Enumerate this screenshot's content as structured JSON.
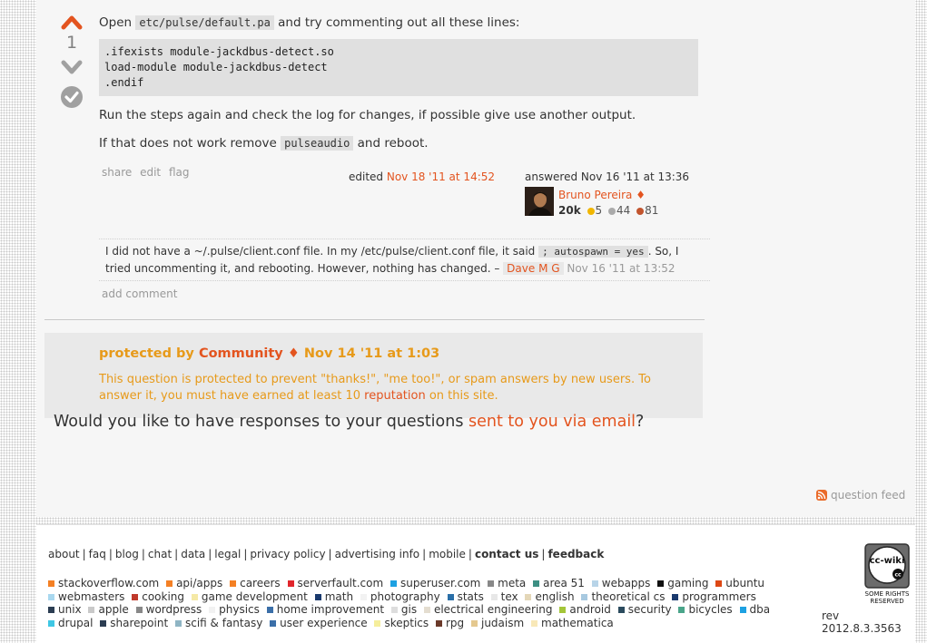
{
  "answer": {
    "vote_count": "1",
    "icons": {
      "upvote": "arrow-up-icon",
      "downvote": "arrow-down-icon",
      "accepted": "check-circle-icon"
    },
    "intro_pre": "Open ",
    "intro_code": "etc/pulse/default.pa",
    "intro_post": " and try commenting out all these lines:",
    "code_lines": ".ifexists module-jackdbus-detect.so\nload-module module-jackdbus-detect\n.endif",
    "para2": "Run the steps again and check the log for changes, if possible give use another output.",
    "para3_pre": "If that does not work remove ",
    "para3_code": "pulseaudio",
    "para3_post": " and reboot.",
    "menu": {
      "share": "share",
      "edit": "edit",
      "flag": "flag"
    },
    "edited_label": "edited ",
    "edited_date": "Nov 18 '11 at 14:52",
    "answered_label": "answered Nov 16 '11 at 13:36",
    "user": {
      "name": "Bruno Pereira",
      "moderator_diamond": "♦",
      "reputation": "20k",
      "gold": "5",
      "silver": "44",
      "bronze": "81"
    }
  },
  "comment": {
    "text_pre": "I did not have a ~/.pulse/client.conf file. In my /etc/pulse/client.conf file, it said ",
    "code": "; autospawn = yes",
    "text_post": ". So, I tried uncommenting it, and rebooting. However, nothing has changed. – ",
    "user": "Dave M G",
    "date": "Nov 16 '11 at 13:52"
  },
  "add_comment": "add comment",
  "protected": {
    "prefix": "protected by ",
    "user": "Community",
    "diamond": "♦",
    "date": "Nov 14 '11 at 1:03",
    "text_pre": "This question is protected to prevent \"thanks!\", \"me too!\", or spam answers by new users. To answer it, you must have earned at least 10 ",
    "link": "reputation",
    "text_post": " on this site."
  },
  "email_prompt": {
    "pre": "Would you like to have responses to your questions ",
    "link": "sent to you via email",
    "post": "?"
  },
  "question_feed": "question feed",
  "footer": {
    "menu": [
      {
        "label": "about",
        "bold": false
      },
      {
        "label": "faq",
        "bold": false
      },
      {
        "label": "blog",
        "bold": false
      },
      {
        "label": "chat",
        "bold": false
      },
      {
        "label": "data",
        "bold": false
      },
      {
        "label": "legal",
        "bold": false
      },
      {
        "label": "privacy policy",
        "bold": false
      },
      {
        "label": "advertising info",
        "bold": false
      },
      {
        "label": "mobile",
        "bold": false
      },
      {
        "label": "contact us",
        "bold": true
      },
      {
        "label": "feedback",
        "bold": true
      }
    ],
    "sites": [
      {
        "label": "stackoverflow.com",
        "color": "#f48024"
      },
      {
        "label": "api/apps",
        "color": "#f48024"
      },
      {
        "label": "careers",
        "color": "#f48024"
      },
      {
        "label": "serverfault.com",
        "color": "#e1262c"
      },
      {
        "label": "superuser.com",
        "color": "#1da1e2"
      },
      {
        "label": "meta",
        "color": "#888888"
      },
      {
        "label": "area 51",
        "color": "#3d8f83"
      },
      {
        "label": "webapps",
        "color": "#b8d4e8"
      },
      {
        "label": "gaming",
        "color": "#111111"
      },
      {
        "label": "ubuntu",
        "color": "#dd4814"
      },
      {
        "label": "webmasters",
        "color": "#a9d8ef"
      },
      {
        "label": "cooking",
        "color": "#c0392b"
      },
      {
        "label": "game development",
        "color": "#f5e9a6"
      },
      {
        "label": "math",
        "color": "#1a3a6e"
      },
      {
        "label": "photography",
        "color": "#f2f2f2"
      },
      {
        "label": "stats",
        "color": "#2a6fa8"
      },
      {
        "label": "tex",
        "color": "#e7e7e7"
      },
      {
        "label": "english",
        "color": "#e4d7b8"
      },
      {
        "label": "theoretical cs",
        "color": "#a8c9e0"
      },
      {
        "label": "programmers",
        "color": "#1a3a6e"
      },
      {
        "label": "unix",
        "color": "#2b3d52"
      },
      {
        "label": "apple",
        "color": "#c9c9c9"
      },
      {
        "label": "wordpress",
        "color": "#888888"
      },
      {
        "label": "physics",
        "color": "#f2f2f2"
      },
      {
        "label": "home improvement",
        "color": "#3b6fa8"
      },
      {
        "label": "gis",
        "color": "#dddddd"
      },
      {
        "label": "electrical engineering",
        "color": "#e4ddd0"
      },
      {
        "label": "android",
        "color": "#a4c639"
      },
      {
        "label": "security",
        "color": "#2b4b5e"
      },
      {
        "label": "bicycles",
        "color": "#4aa58a"
      },
      {
        "label": "dba",
        "color": "#1da1e2"
      },
      {
        "label": "drupal",
        "color": "#3fc7e4"
      },
      {
        "label": "sharepoint",
        "color": "#2b3d52"
      },
      {
        "label": "scifi & fantasy",
        "color": "#8fb5c4"
      },
      {
        "label": "user experience",
        "color": "#3b6fa8"
      },
      {
        "label": "skeptics",
        "color": "#f5ee9c"
      },
      {
        "label": "rpg",
        "color": "#6b3a2a"
      },
      {
        "label": "judaism",
        "color": "#e4c88f"
      },
      {
        "label": "mathematica",
        "color": "#f8e8b8"
      }
    ],
    "license": {
      "badge": "cc-wiki",
      "caption": "SOME RIGHTS RESERVED"
    },
    "rev": "rev 2012.8.3.3563"
  }
}
